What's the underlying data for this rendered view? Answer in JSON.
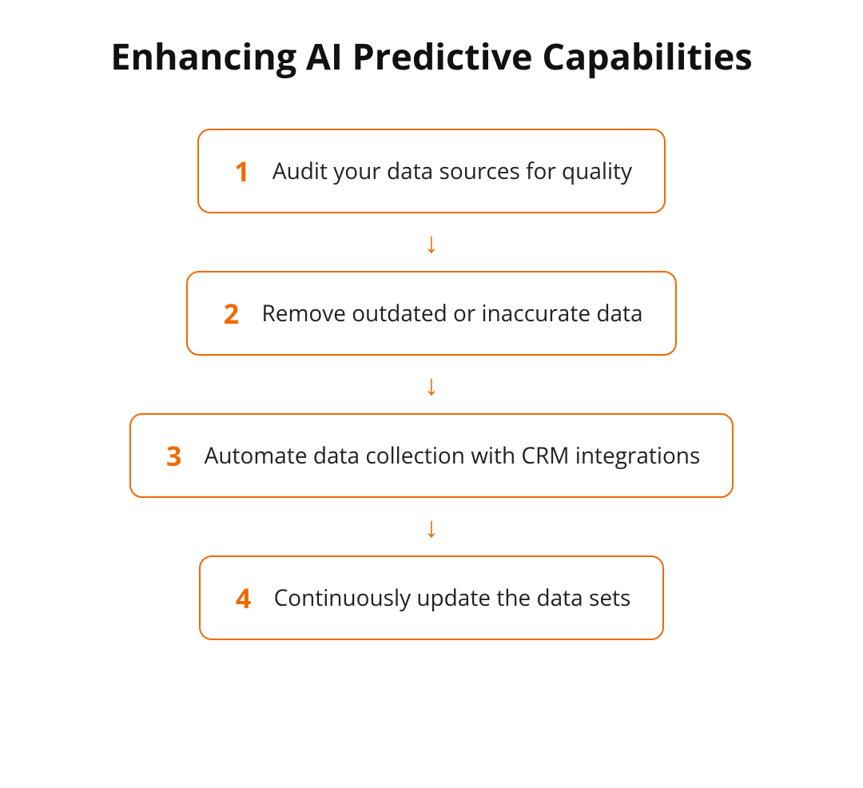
{
  "title": "Enhancing AI Predictive Capabilities",
  "steps": [
    {
      "num": "1",
      "text": "Audit your data sources for quality"
    },
    {
      "num": "2",
      "text": "Remove outdated or inaccurate data"
    },
    {
      "num": "3",
      "text": "Automate data collection with CRM integrations"
    },
    {
      "num": "4",
      "text": "Continuously update the data sets"
    }
  ],
  "colors": {
    "accent": "#ef6a00"
  }
}
